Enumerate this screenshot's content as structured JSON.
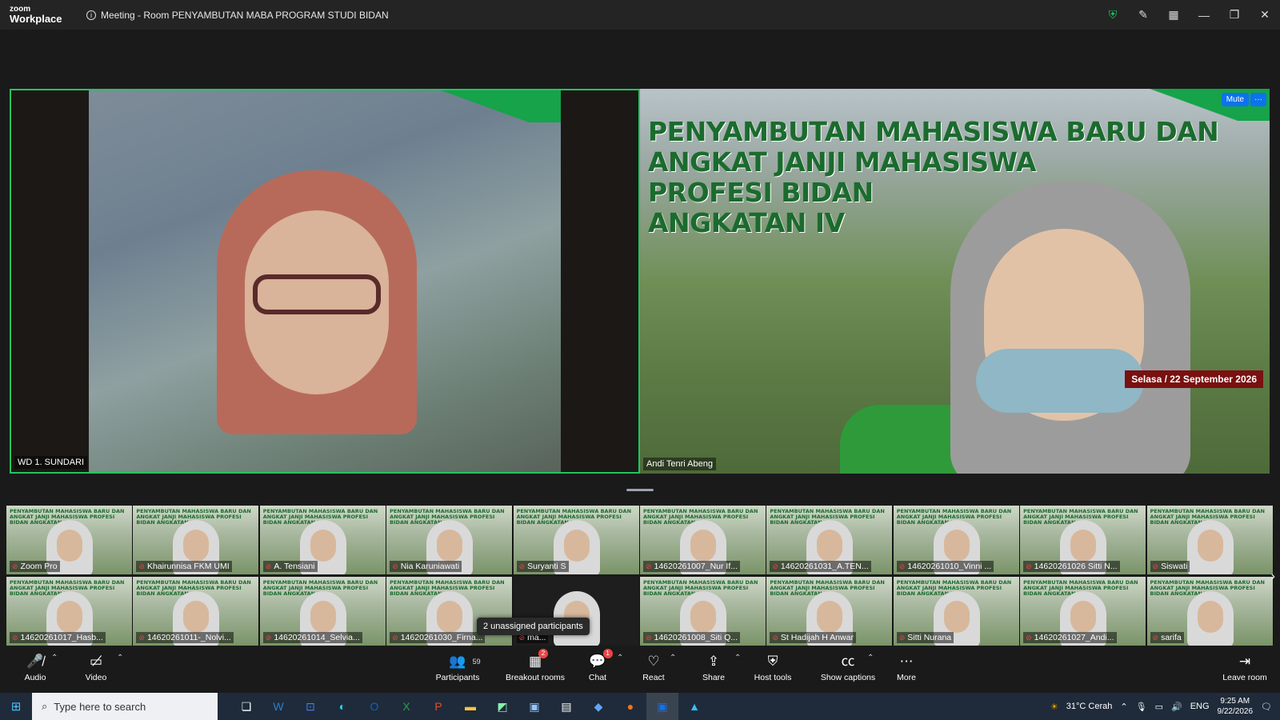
{
  "app": {
    "logo_line1": "zoom",
    "logo_line2": "Workplace"
  },
  "meeting": {
    "title": "Meeting - Room PENYAMBUTAN MABA PROGRAM STUDI BIDAN"
  },
  "main_tiles": [
    {
      "name": "WD 1. SUNDARI"
    },
    {
      "name": "Andi Tenri Abeng",
      "mute_label": "Mute",
      "more_label": "···",
      "slide_title": [
        "PENYAMBUTAN MAHASISWA BARU DAN",
        "ANGKAT JANJI MAHASISWA",
        "PROFESI BIDAN",
        "ANGKATAN IV"
      ],
      "date_text": "Selasa / 22 September 2026"
    }
  ],
  "gallery": {
    "mini_title": "PENYAMBUTAN MAHASISWA BARU DAN ANGKAT JANJI MAHASISWA PROFESI BIDAN ANGKATAN IV",
    "row1": [
      "Zoom Pro",
      "Khairunnisa FKM UMI",
      "A. Tensiani",
      "Nia Karuniawati",
      "Suryanti S",
      "14620261007_Nur If...",
      "14620261031_A.TEN...",
      "14620261010_Vinni ...",
      "14620261026 Sitti N...",
      "Siswati"
    ],
    "row2": [
      "14620261017_Hasb...",
      "14620261011-_Nolvi...",
      "14620261014_Selvia...",
      "14620261030_Firna...",
      "ma...",
      "14620261008_Siti Q...",
      "St Hadijah H Anwar",
      "Sitti Nurana",
      "14620261027_Andi...",
      "sarifa"
    ],
    "unassigned": "2 unassigned participants"
  },
  "toolbar": {
    "audio": "Audio",
    "video": "Video",
    "participants": "Participants",
    "participants_count": "59",
    "breakout": "Breakout rooms",
    "breakout_badge": "2",
    "chat": "Chat",
    "chat_badge": "1",
    "react": "React",
    "share": "Share",
    "host_tools": "Host tools",
    "captions": "Show captions",
    "more": "More",
    "leave": "Leave room"
  },
  "taskbar": {
    "search_placeholder": "Type here to search",
    "weather": "31°C  Cerah",
    "lang": "ENG",
    "time": "9:25 AM",
    "date": "9/22/2026"
  },
  "colors": {
    "active_speaker": "#22c55e",
    "accent": "#0e72ed",
    "alert": "#ef4444"
  }
}
